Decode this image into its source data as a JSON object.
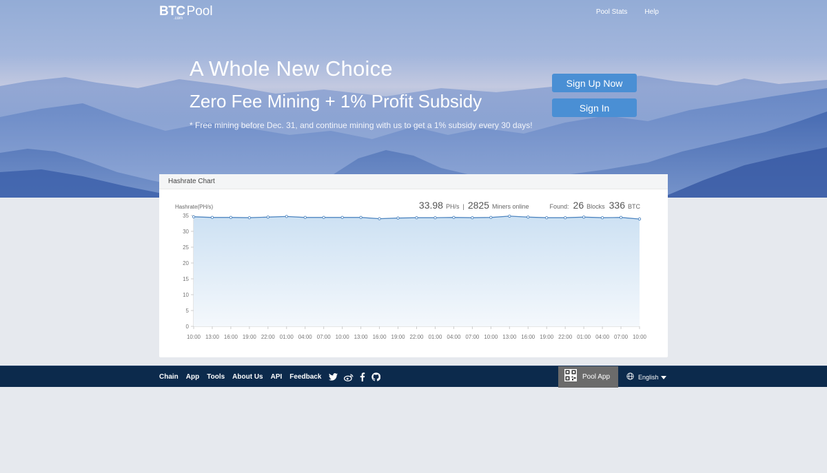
{
  "header": {
    "logo_btc": "BTC",
    "logo_com": ".com",
    "logo_pool": "Pool",
    "nav": [
      {
        "label": "Pool Stats"
      },
      {
        "label": "Help"
      }
    ]
  },
  "hero": {
    "title": "A Whole New Choice",
    "subtitle": "Zero Fee Mining + 1% Profit Subsidy",
    "notice": "* Free mining before Dec. 31, and continue mining with us to get a 1% subsidy every 30 days!",
    "signup_label": "Sign Up Now",
    "signin_label": "Sign In"
  },
  "chart_card": {
    "title": "Hashrate Chart",
    "hashrate_value": "33.98",
    "hashrate_unit": "PH/s",
    "separator": "|",
    "miners_value": "2825",
    "miners_label": "Miners online",
    "found_label": "Found:",
    "blocks_value": "26",
    "blocks_label": "Blocks",
    "btc_value": "336",
    "btc_label": "BTC"
  },
  "chart_data": {
    "type": "area",
    "ylabel": "Hashrate(PH/s)",
    "ylim": [
      0,
      35
    ],
    "yticks": [
      0,
      5,
      10,
      15,
      20,
      25,
      30,
      35
    ],
    "x": [
      "10:00",
      "13:00",
      "16:00",
      "19:00",
      "22:00",
      "01:00",
      "04:00",
      "07:00",
      "10:00",
      "13:00",
      "16:00",
      "19:00",
      "22:00",
      "01:00",
      "04:00",
      "07:00",
      "10:00",
      "13:00",
      "16:00",
      "19:00",
      "22:00",
      "01:00",
      "04:00",
      "07:00",
      "10:00"
    ],
    "series": [
      {
        "values": [
          34.6,
          34.4,
          34.4,
          34.3,
          34.5,
          34.7,
          34.4,
          34.4,
          34.4,
          34.4,
          34.0,
          34.2,
          34.3,
          34.3,
          34.4,
          34.3,
          34.4,
          34.8,
          34.5,
          34.3,
          34.3,
          34.5,
          34.3,
          34.4,
          33.9
        ]
      }
    ],
    "colors": {
      "line": "#4f86c0",
      "fill_top": "#cde1f3",
      "fill_bottom": "#f4f8fc"
    }
  },
  "footer": {
    "links": [
      "Chain",
      "App",
      "Tools",
      "About Us",
      "API",
      "Feedback"
    ],
    "social_icons": [
      "twitter-icon",
      "weibo-icon",
      "facebook-icon",
      "github-icon"
    ],
    "pool_app_label": "Pool App",
    "language_label": "English"
  }
}
